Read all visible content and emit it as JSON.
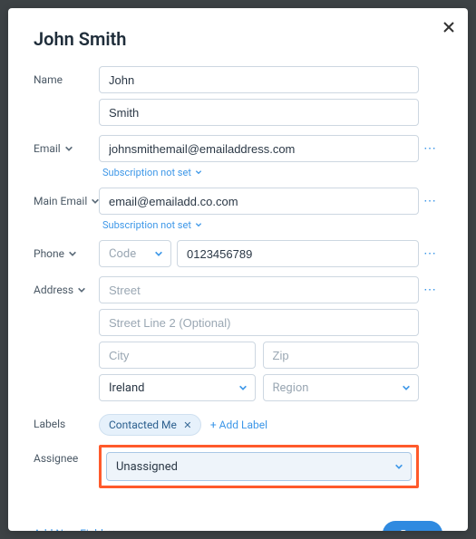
{
  "header": {
    "title": "John Smith"
  },
  "labels": {
    "name": "Name",
    "email": "Email",
    "main_email": "Main Email",
    "phone": "Phone",
    "address": "Address",
    "labels": "Labels",
    "assignee": "Assignee"
  },
  "name": {
    "first": "John",
    "last": "Smith"
  },
  "email": {
    "value": "johnsmithemail@emailaddress.com",
    "subscription_text": "Subscription not set"
  },
  "main_email": {
    "value": "email@emailadd.co.com",
    "subscription_text": "Subscription not set"
  },
  "phone": {
    "code_placeholder": "Code",
    "number": "0123456789"
  },
  "address": {
    "street_ph": "Street",
    "street2_ph": "Street Line 2 (Optional)",
    "city_ph": "City",
    "zip_ph": "Zip",
    "country": "Ireland",
    "region_ph": "Region"
  },
  "labels_field": {
    "chip": "Contacted Me",
    "add_label": "+ Add Label"
  },
  "assignee": {
    "value": "Unassigned"
  },
  "footer": {
    "add_field": "Add New Field",
    "save": "Save"
  }
}
